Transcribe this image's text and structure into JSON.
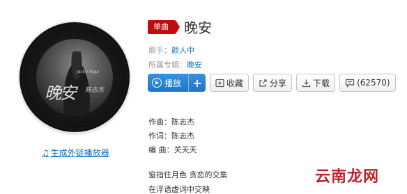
{
  "album": {
    "cover_text": "晚安",
    "cover_signature": "陈志杰",
    "cover_small": "Jocky Yoga"
  },
  "generate_link": {
    "icon": "music-note-icon",
    "label": "生成外链播放器"
  },
  "song": {
    "badge": "单曲",
    "title": "晚安",
    "singer_label": "歌手：",
    "singer": "颜人中",
    "album_label": "所属专辑：",
    "album": "晚安"
  },
  "actions": {
    "play": "播放",
    "add": "+",
    "collect": "收藏",
    "share": "分享",
    "download": "下载",
    "comments": "(62570)"
  },
  "credits": [
    "作曲：陈志杰",
    "作词：陈志杰",
    "编 曲：关天天"
  ],
  "lyrics": [
    "窗指住月色 贪恋的交集",
    "在浮语虚词中交映"
  ],
  "watermark": {
    "text": "云南龙网"
  },
  "colors": {
    "accent_red": "#c20c0c",
    "link_blue": "#0c73c2",
    "play_blue": "#1e74c7"
  }
}
